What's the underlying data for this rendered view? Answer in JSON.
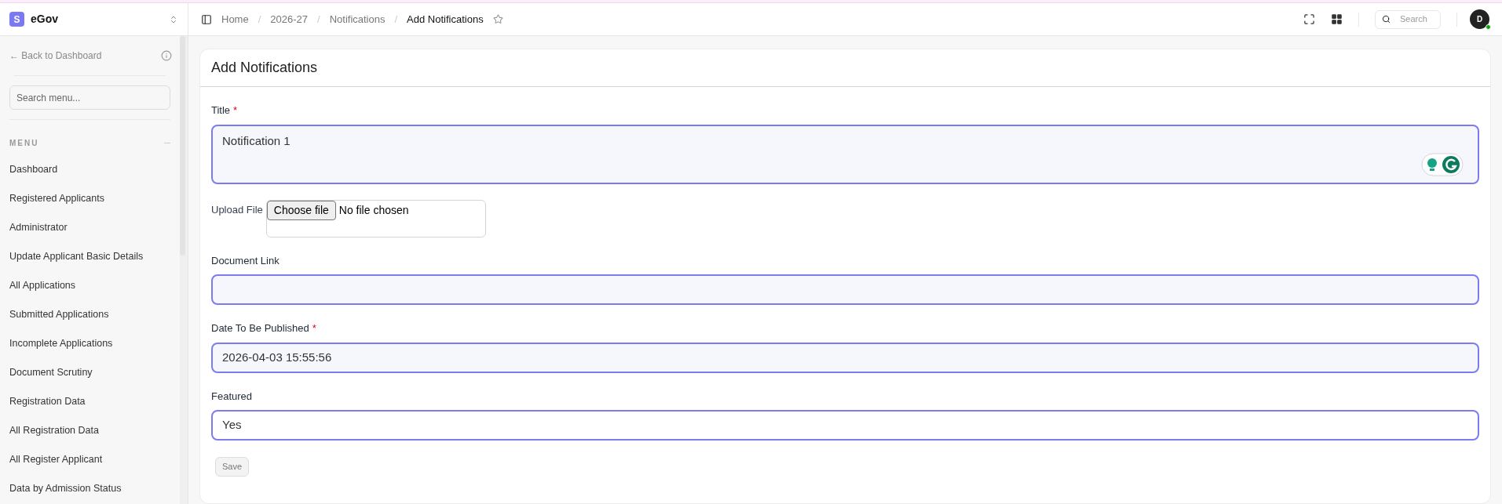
{
  "app": {
    "logo_letter": "S",
    "name": "eGov"
  },
  "breadcrumb_separator": "/",
  "breadcrumbs": [
    {
      "label": "Home",
      "current": false
    },
    {
      "label": "2026-27",
      "current": false
    },
    {
      "label": "Notifications",
      "current": false
    },
    {
      "label": "Add Notifications",
      "current": true
    }
  ],
  "header": {
    "search_placeholder": "Search",
    "avatar_letter": "D",
    "online": true
  },
  "sidebar": {
    "back_link": "← Back to Dashboard",
    "search_placeholder": "Search menu...",
    "section_title": "MENU",
    "items": [
      {
        "label": "Dashboard"
      },
      {
        "label": "Registered Applicants"
      },
      {
        "label": "Administrator"
      },
      {
        "label": "Update Applicant Basic Details"
      },
      {
        "label": "All Applications"
      },
      {
        "label": "Submitted Applications"
      },
      {
        "label": "Incomplete Applications"
      },
      {
        "label": "Document Scrutiny"
      },
      {
        "label": "Registration Data"
      },
      {
        "label": "All Registration Data"
      },
      {
        "label": "All Register Applicant"
      },
      {
        "label": "Data by Admission Status"
      }
    ]
  },
  "form": {
    "title": "Add Notifications",
    "required_mark": "*",
    "fields": [
      {
        "kind": "textarea",
        "label": "Title",
        "required": true,
        "value": "Notification 1"
      },
      {
        "kind": "file",
        "label": "Upload File",
        "button": "Choose file",
        "status": "No file chosen"
      },
      {
        "kind": "text",
        "label": "Document Link",
        "required": false
      },
      {
        "kind": "text",
        "label": "Date To Be Published",
        "required": true,
        "value": "2026-04-03 15:55:56"
      },
      {
        "kind": "select",
        "label": "Featured",
        "required": false,
        "value": "Yes"
      }
    ],
    "save_button": "Save"
  }
}
